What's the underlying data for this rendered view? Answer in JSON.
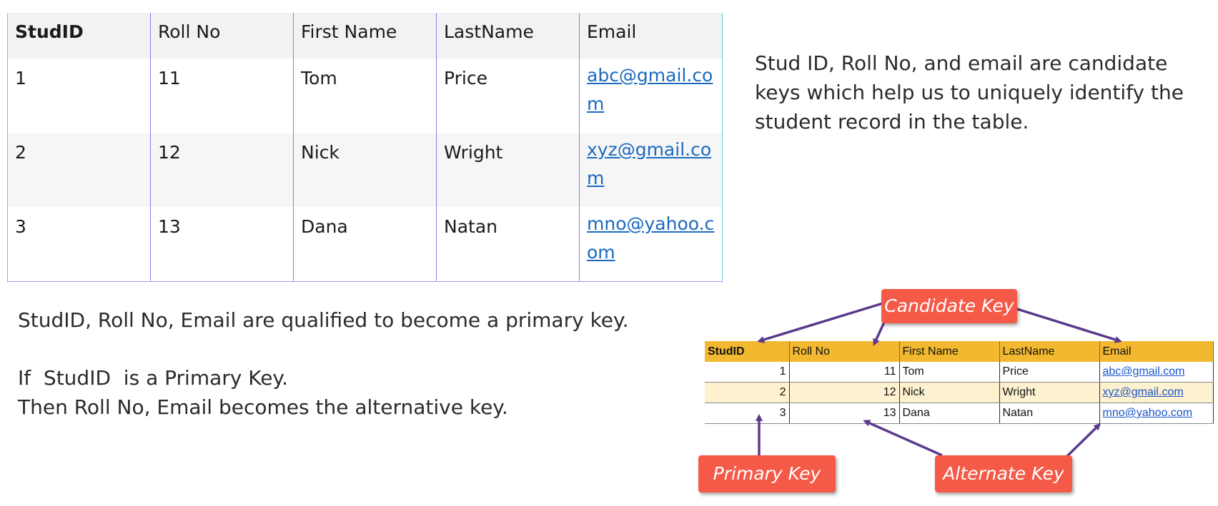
{
  "main_table": {
    "headers": [
      "StudID",
      "Roll No",
      "First Name",
      "LastName",
      "Email"
    ],
    "rows": [
      {
        "stud_id": "1",
        "roll_no": "11",
        "first_name": "Tom",
        "last_name": "Price",
        "email": "abc@gmail.com"
      },
      {
        "stud_id": "2",
        "roll_no": "12",
        "first_name": "Nick",
        "last_name": "Wright",
        "email": "xyz@gmail.com"
      },
      {
        "stud_id": "3",
        "roll_no": "13",
        "first_name": "Dana",
        "last_name": "Natan",
        "email": "mno@yahoo.com"
      }
    ]
  },
  "notes": {
    "candidate": "Stud ID, Roll No, and email are candidate keys which help us to uniquely identify the student record in the table.",
    "qualified": "StudID, Roll No, Email are qualified to become a primary key.",
    "primary_line1": "If  StudID  is a Primary Key.",
    "primary_line2": "Then Roll No, Email becomes the alternative key."
  },
  "diagram": {
    "headers": [
      "StudID",
      "Roll No",
      "First Name",
      "LastName",
      "Email"
    ],
    "rows": [
      {
        "stud_id": "1",
        "roll_no": "11",
        "first_name": "Tom",
        "last_name": "Price",
        "email": "abc@gmail.com"
      },
      {
        "stud_id": "2",
        "roll_no": "12",
        "first_name": "Nick",
        "last_name": "Wright",
        "email": "xyz@gmail.com"
      },
      {
        "stud_id": "3",
        "roll_no": "13",
        "first_name": "Dana",
        "last_name": "Natan",
        "email": "mno@yahoo.com"
      }
    ],
    "labels": {
      "candidate": "Candidate Key",
      "primary": "Primary Key",
      "alternate": "Alternate Key"
    },
    "colors": {
      "label_bg": "#f45a47",
      "header_bg": "#f2b830",
      "arrow": "#5a3a8c"
    }
  }
}
